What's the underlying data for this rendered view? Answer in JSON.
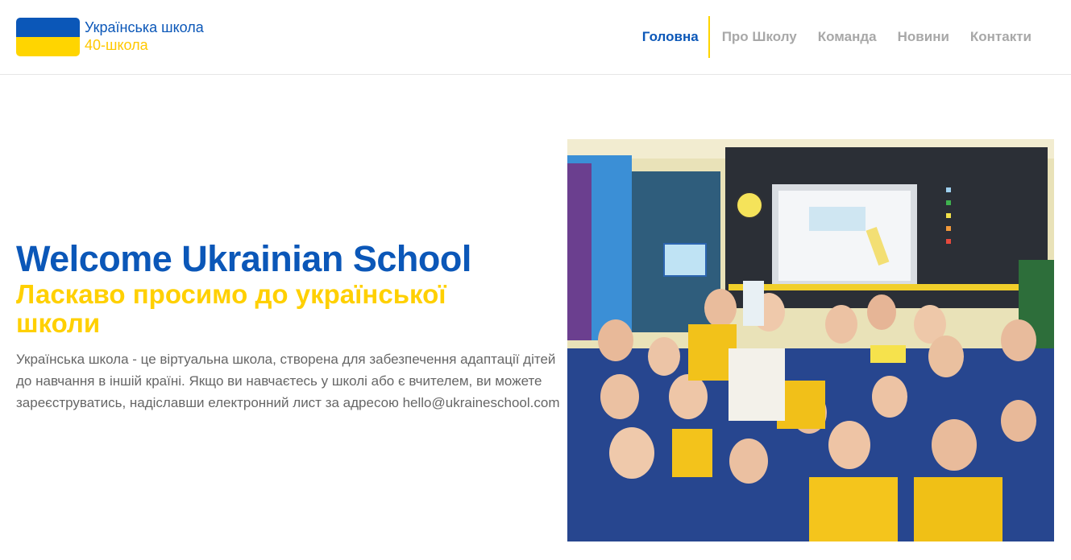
{
  "colors": {
    "brand_blue": "#0b57b8",
    "brand_yellow": "#ffd500",
    "nav_inactive": "#a8a8a8",
    "text_gray": "#666666"
  },
  "logo": {
    "line1": "Українська школа",
    "line2": "40-школа",
    "flag_icon": "ukraine-flag-icon"
  },
  "nav": {
    "items": [
      {
        "label": "Головна",
        "active": true
      },
      {
        "label": "Про Школу",
        "active": false
      },
      {
        "label": "Команда",
        "active": false
      },
      {
        "label": "Новини",
        "active": false
      },
      {
        "label": "Контакти",
        "active": false
      }
    ]
  },
  "hero": {
    "title": "Welcome Ukrainian School",
    "subtitle": "Ласкаво просимо до української школи",
    "description": "Українська школа - це віртуальна школа, створена для забезпечення адаптації дітей до навчання в іншій країні. Якщо ви навчаєтесь у школі або є вчителем, ви можете зареєструватись, надіславши електронний лист за адресою hello@ukraineschool.com"
  }
}
